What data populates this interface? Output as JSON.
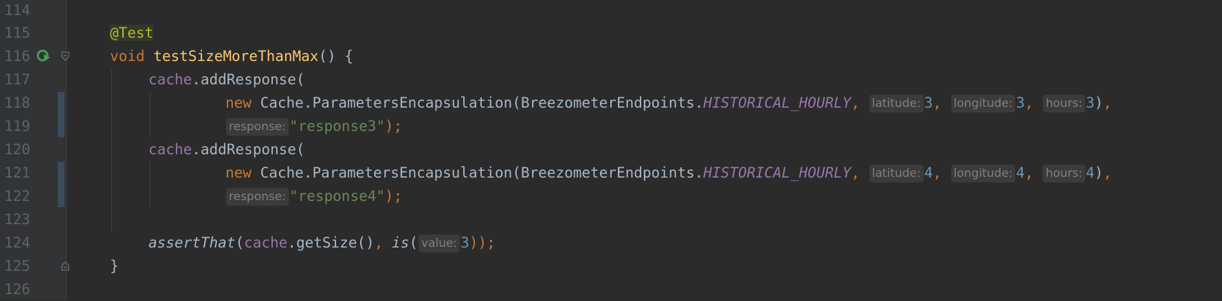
{
  "editor": {
    "line_numbers": [
      "114",
      "115",
      "116",
      "117",
      "118",
      "119",
      "120",
      "121",
      "122",
      "123",
      "124",
      "125",
      "126"
    ],
    "tokens": {
      "annotation": "@Test",
      "kw_void": "void",
      "method_name": "testSizeMoreThanMax",
      "method_tail": "() {",
      "cache": "cache",
      "add_response": ".addResponse(",
      "kw_new": "new",
      "ctor": " Cache.ParametersEncapsulation(BreezometerEndpoints.",
      "const": "HISTORICAL_HOURLY",
      "comma": ", ",
      "comma_end": ",",
      "close_paren": ")",
      "close_stmt": ");",
      "hint_latitude": "latitude:",
      "hint_longitude": "longitude:",
      "hint_hours": "hours:",
      "hint_response": "response:",
      "hint_value": "value:",
      "n3": "3",
      "n4": "4",
      "str3": "\"response3\"",
      "str4": "\"response4\"",
      "assert_that": "assertThat",
      "open_paren": "(",
      "get_size": ".getSize()",
      "is_fn": "is",
      "close_two_stmt": "));",
      "close_brace": "}"
    }
  }
}
